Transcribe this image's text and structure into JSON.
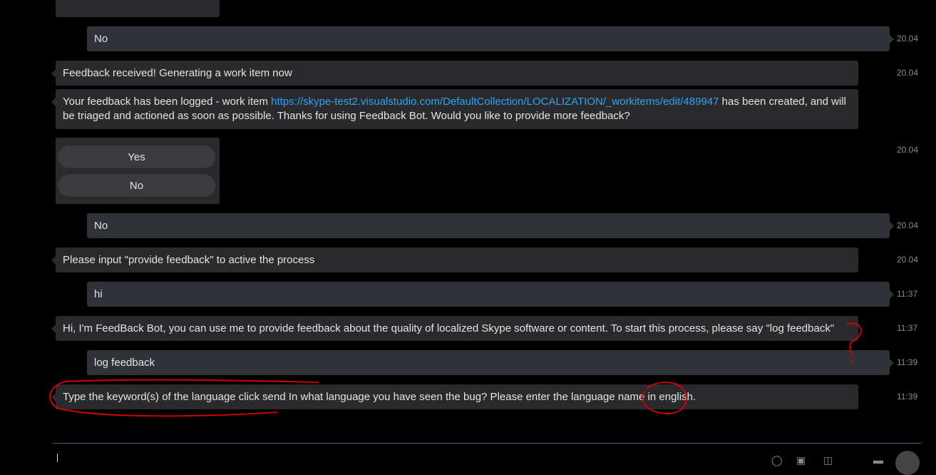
{
  "messages": {
    "top_choice_no": "No",
    "m1": {
      "text": "No",
      "time": "20.04"
    },
    "m2": {
      "text": "Feedback received! Generating a work item now",
      "time": "20.04"
    },
    "m3": {
      "prefix": "Your feedback has been logged - work item ",
      "link": "https://skype-test2.visualstudio.com/DefaultCollection/LOCALIZATION/_workitems/edit/489947",
      "suffix": " has been created, and will be triaged and actioned as soon as possible. Thanks for using Feedback Bot. Would you like to provide more feedback?"
    },
    "choices": {
      "yes": "Yes",
      "no": "No",
      "time": "20.04"
    },
    "m4": {
      "text": "No",
      "time": "20.04"
    },
    "m5": {
      "text": "Please input \"provide feedback\" to active the process",
      "time": "20.04"
    },
    "m6": {
      "text": "hi",
      "time": "11:37"
    },
    "m7": {
      "text": "Hi, I'm FeedBack Bot, you can use me to provide feedback about the quality of localized Skype software or content. To start this process, please say \"log feedback\"",
      "time": "11:37"
    },
    "m8": {
      "text": "log feedback",
      "time": "11:39"
    },
    "m9": {
      "text": "Type the keyword(s) of the language click send In what language you have seen the bug? Please enter the language name in english.",
      "time": "11:39"
    }
  },
  "colors": {
    "link": "#2ea3f2",
    "annotation": "#e00000",
    "divider": "#3f5f8f"
  }
}
